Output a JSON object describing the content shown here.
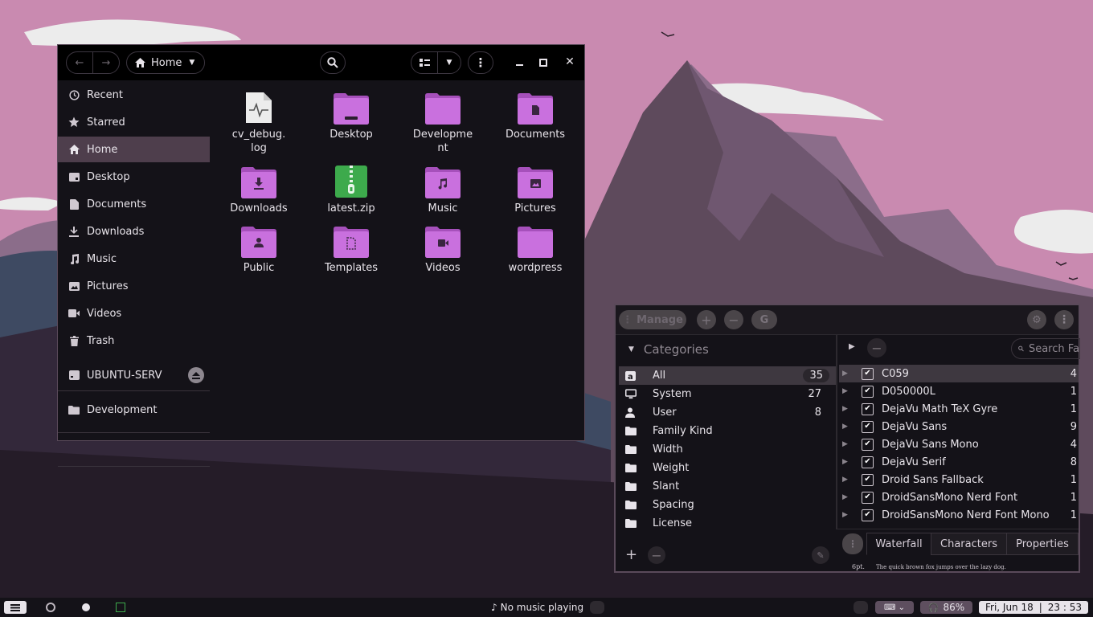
{
  "colors": {
    "accent": "#c77ddb",
    "folder": "#c970de",
    "zip": "#3daa4c",
    "sky": "#c98ab0"
  },
  "filemanager": {
    "location": "Home",
    "sidebar": [
      {
        "label": "Recent",
        "icon": "clock-icon"
      },
      {
        "label": "Starred",
        "icon": "star-icon"
      },
      {
        "label": "Home",
        "icon": "home-icon"
      },
      {
        "label": "Desktop",
        "icon": "desktop-icon"
      },
      {
        "label": "Documents",
        "icon": "document-icon"
      },
      {
        "label": "Downloads",
        "icon": "download-icon"
      },
      {
        "label": "Music",
        "icon": "music-icon"
      },
      {
        "label": "Pictures",
        "icon": "picture-icon"
      },
      {
        "label": "Videos",
        "icon": "video-icon"
      },
      {
        "label": "Trash",
        "icon": "trash-icon"
      },
      {
        "label": "UBUNTU-SERV",
        "icon": "drive-icon"
      },
      {
        "label": "Development",
        "icon": "folder-icon"
      }
    ],
    "files": [
      {
        "name": "cv_debug.\nlog",
        "type": "log-file"
      },
      {
        "name": "Desktop",
        "type": "desktop-folder"
      },
      {
        "name": "Developme\nnt",
        "type": "folder"
      },
      {
        "name": "Documents",
        "type": "documents-folder"
      },
      {
        "name": "Downloads",
        "type": "downloads-folder"
      },
      {
        "name": "latest.zip",
        "type": "zip-file"
      },
      {
        "name": "Music",
        "type": "music-folder"
      },
      {
        "name": "Pictures",
        "type": "pictures-folder"
      },
      {
        "name": "Public",
        "type": "public-folder"
      },
      {
        "name": "Templates",
        "type": "templates-folder"
      },
      {
        "name": "Videos",
        "type": "videos-folder"
      },
      {
        "name": "wordpress",
        "type": "folder"
      }
    ]
  },
  "fontmanager": {
    "manage_label": "Manage",
    "categories_label": "Categories",
    "search_placeholder": "Search Fa",
    "categories": [
      {
        "label": "All",
        "count": "35",
        "icon": "all-fonts-icon"
      },
      {
        "label": "System",
        "count": "27",
        "icon": "monitor-icon"
      },
      {
        "label": "User",
        "count": "8",
        "icon": "user-icon"
      },
      {
        "label": "Family Kind",
        "count": "",
        "icon": "folder-icon"
      },
      {
        "label": "Width",
        "count": "",
        "icon": "folder-icon"
      },
      {
        "label": "Weight",
        "count": "",
        "icon": "folder-icon"
      },
      {
        "label": "Slant",
        "count": "",
        "icon": "folder-icon"
      },
      {
        "label": "Spacing",
        "count": "",
        "icon": "folder-icon"
      },
      {
        "label": "License",
        "count": "",
        "icon": "folder-icon"
      }
    ],
    "fonts": [
      {
        "name": "C059",
        "count": "4"
      },
      {
        "name": "D050000L",
        "count": "1"
      },
      {
        "name": "DejaVu Math TeX Gyre",
        "count": "1"
      },
      {
        "name": "DejaVu Sans",
        "count": "9"
      },
      {
        "name": "DejaVu Sans Mono",
        "count": "4"
      },
      {
        "name": "DejaVu Serif",
        "count": "8"
      },
      {
        "name": "Droid Sans Fallback",
        "count": "1"
      },
      {
        "name": "DroidSansMono Nerd Font",
        "count": "1"
      },
      {
        "name": "DroidSansMono Nerd Font Mono",
        "count": "1"
      }
    ],
    "tabs": [
      "Waterfall",
      "Characters",
      "Properties"
    ],
    "preview_size": "6pt.",
    "preview_text": "The quick brown fox jumps over the lazy dog."
  },
  "taskbar": {
    "music": "No music playing",
    "volume": "86%",
    "date": "Fri, Jun 18",
    "time": "23 : 53"
  }
}
